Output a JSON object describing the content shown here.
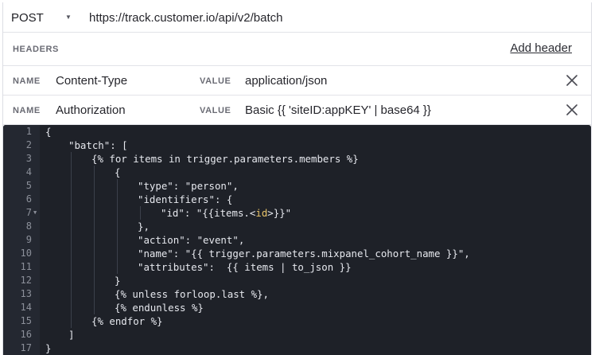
{
  "request": {
    "method": "POST",
    "url": "https://track.customer.io/api/v2/batch"
  },
  "headers_section": {
    "title": "HEADERS",
    "add_label": "Add header",
    "name_label": "NAME",
    "value_label": "VALUE",
    "items": [
      {
        "name": "Content-Type",
        "value": "application/json"
      },
      {
        "name": "Authorization",
        "value": "Basic {{ 'siteID:appKEY' | base64 }}"
      }
    ]
  },
  "icons": {
    "remove": "close-icon",
    "method_caret": "caret-down-icon",
    "fold": "fold-arrow-icon"
  },
  "colors": {
    "editor_bg": "#1e2128",
    "gutter_bg": "#242831",
    "code_text": "#e6e8ee",
    "line_number": "#8c909a",
    "tag_highlight": "#e9c46a"
  },
  "editor": {
    "lines": [
      {
        "n": "1",
        "indent": 0,
        "text": "{"
      },
      {
        "n": "2",
        "indent": 1,
        "text": "\"batch\": ["
      },
      {
        "n": "3",
        "indent": 2,
        "text": "{% for items in trigger.parameters.members %}"
      },
      {
        "n": "4",
        "indent": 3,
        "text": "{"
      },
      {
        "n": "5",
        "indent": 4,
        "text": "\"type\": \"person\","
      },
      {
        "n": "6",
        "indent": 4,
        "text": "\"identifiers\": {"
      },
      {
        "n": "7",
        "indent": 5,
        "fold": true,
        "pre": "\"id\": \"{{items.<",
        "tag": "id",
        "post": ">}}\""
      },
      {
        "n": "8",
        "indent": 4,
        "text": "},"
      },
      {
        "n": "9",
        "indent": 4,
        "text": "\"action\": \"event\","
      },
      {
        "n": "10",
        "indent": 4,
        "text": "\"name\": \"{{ trigger.parameters.mixpanel_cohort_name }}\","
      },
      {
        "n": "11",
        "indent": 4,
        "text": "\"attributes\":  {{ items | to_json }}"
      },
      {
        "n": "12",
        "indent": 3,
        "text": "}"
      },
      {
        "n": "13",
        "indent": 3,
        "text": "{% unless forloop.last %},"
      },
      {
        "n": "14",
        "indent": 3,
        "text": "{% endunless %}"
      },
      {
        "n": "15",
        "indent": 2,
        "text": "{% endfor %}"
      },
      {
        "n": "16",
        "indent": 1,
        "text": "]"
      },
      {
        "n": "17",
        "indent": 0,
        "text": "}"
      }
    ]
  }
}
